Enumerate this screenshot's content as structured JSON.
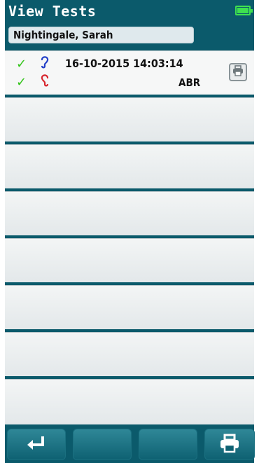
{
  "header": {
    "title": "View Tests",
    "patient_name": "Nightingale, Sarah"
  },
  "status": {
    "battery_icon": "battery-charging-icon",
    "battery_color": "#3ee04f"
  },
  "tests": [
    {
      "datetime": "16-10-2015 14:03:14",
      "test_type": "ABR",
      "right_ear": {
        "icon": "right-ear-icon",
        "color": "#2340c8",
        "status": "check-icon"
      },
      "left_ear": {
        "icon": "left-ear-icon",
        "color": "#d7262e",
        "status": "check-icon"
      },
      "print_icon": "printer-icon"
    }
  ],
  "empty_rows": 7,
  "footer": {
    "buttons": [
      {
        "name": "back-button",
        "icon": "return-arrow-icon"
      },
      {
        "name": "blank-button-2",
        "icon": ""
      },
      {
        "name": "blank-button-3",
        "icon": ""
      },
      {
        "name": "print-button",
        "icon": "printer-icon"
      }
    ]
  },
  "colors": {
    "frame": "#0b5a6b",
    "check": "#32c41a"
  }
}
